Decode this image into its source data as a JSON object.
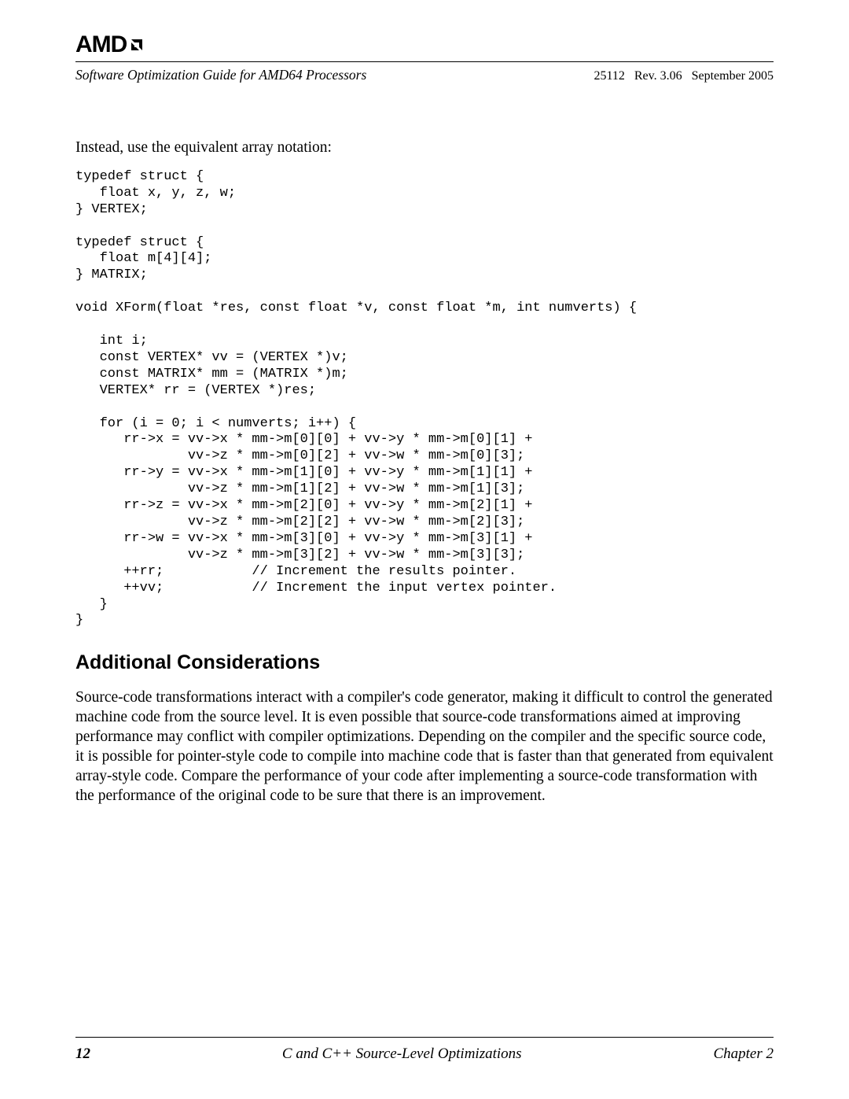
{
  "header": {
    "brand": "AMD",
    "doc_title": "Software Optimization Guide for AMD64 Processors",
    "meta": "25112   Rev. 3.06   September 2005"
  },
  "intro": "Instead, use the equivalent array notation:",
  "code": "typedef struct {\n   float x, y, z, w;\n} VERTEX;\n\ntypedef struct {\n   float m[4][4];\n} MATRIX;\n\nvoid XForm(float *res, const float *v, const float *m, int numverts) {\n\n   int i;\n   const VERTEX* vv = (VERTEX *)v;\n   const MATRIX* mm = (MATRIX *)m;\n   VERTEX* rr = (VERTEX *)res;\n\n   for (i = 0; i < numverts; i++) {\n      rr->x = vv->x * mm->m[0][0] + vv->y * mm->m[0][1] +\n              vv->z * mm->m[0][2] + vv->w * mm->m[0][3];\n      rr->y = vv->x * mm->m[1][0] + vv->y * mm->m[1][1] +\n              vv->z * mm->m[1][2] + vv->w * mm->m[1][3];\n      rr->z = vv->x * mm->m[2][0] + vv->y * mm->m[2][1] +\n              vv->z * mm->m[2][2] + vv->w * mm->m[2][3];\n      rr->w = vv->x * mm->m[3][0] + vv->y * mm->m[3][1] +\n              vv->z * mm->m[3][2] + vv->w * mm->m[3][3];\n      ++rr;           // Increment the results pointer.\n      ++vv;           // Increment the input vertex pointer.\n   }\n}",
  "section_heading": "Additional Considerations",
  "paragraph": "Source-code transformations interact with a compiler's code generator, making it difficult to control the generated machine code from the source level. It is even possible that source-code transformations aimed at improving performance may conflict with compiler optimizations. Depending on the compiler and the specific source code, it is possible for pointer-style code to compile into machine code that is faster than that generated from equivalent array-style code. Compare the performance of your code after implementing a source-code transformation with the performance of the original code to be sure that there is an improvement.",
  "footer": {
    "page_number": "12",
    "center": "C and C++ Source-Level Optimizations",
    "right": "Chapter 2"
  }
}
